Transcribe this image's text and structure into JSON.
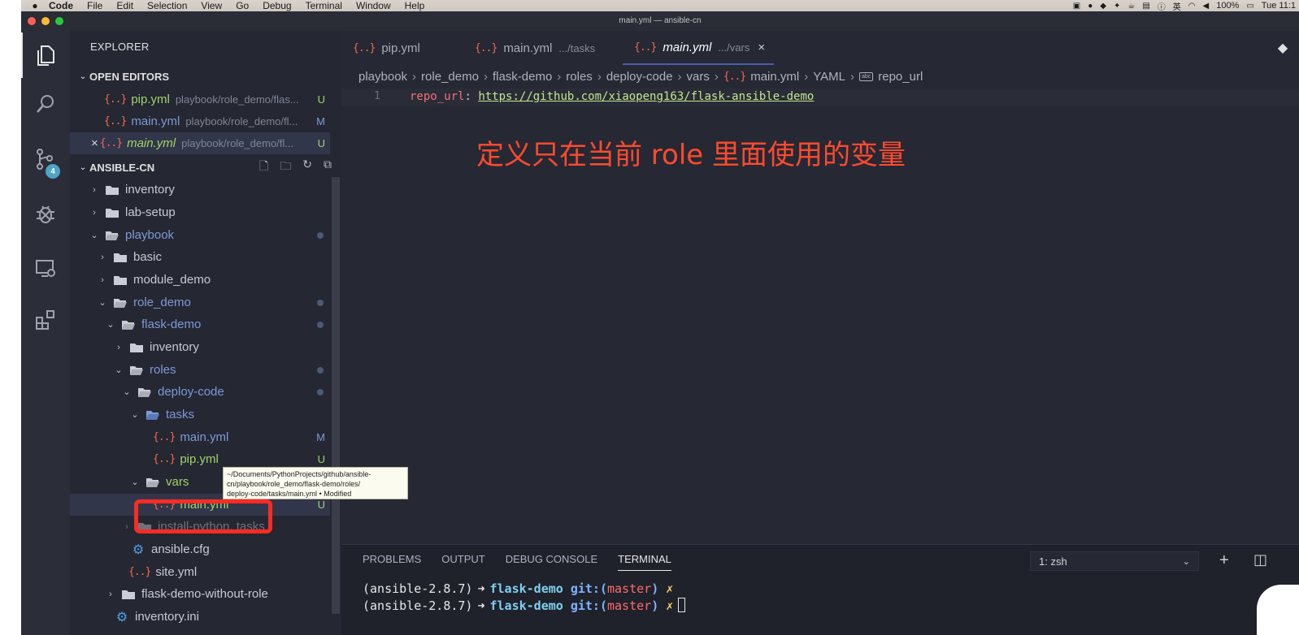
{
  "menubar": {
    "apple": "",
    "items": [
      "Code",
      "File",
      "Edit",
      "Selection",
      "View",
      "Go",
      "Debug",
      "Terminal",
      "Window",
      "Help"
    ],
    "status_icons": [
      "display-icon",
      "wechat-icon",
      "message-icon",
      "dropbox-icon",
      "cup-icon",
      "box-icon",
      "info-icon",
      "input-method-icon",
      "wifi-icon",
      "volume-icon"
    ],
    "input_method": "英",
    "battery": "100%",
    "clock": "Tue 11:1"
  },
  "window": {
    "title": "main.yml — ansible-cn"
  },
  "activitybar": {
    "source_control_badge": "4"
  },
  "sidebar": {
    "title": "EXPLORER",
    "open_editors_label": "OPEN EDITORS",
    "open_editors": [
      {
        "name": "pip.yml",
        "path": "playbook/role_demo/flas...",
        "status": "U"
      },
      {
        "name": "main.yml",
        "path": "playbook/role_demo/fl...",
        "status": "M"
      },
      {
        "name": "main.yml",
        "path": "playbook/role_demo/fl...",
        "status": "U",
        "close": "×"
      }
    ],
    "workspace_label": "ANSIBLE-CN",
    "tree": [
      {
        "name": "inventory"
      },
      {
        "name": "lab-setup"
      },
      {
        "name": "playbook"
      },
      {
        "name": "basic"
      },
      {
        "name": "module_demo"
      },
      {
        "name": "role_demo"
      },
      {
        "name": "flask-demo"
      },
      {
        "name": "inventory"
      },
      {
        "name": "roles"
      },
      {
        "name": "deploy-code"
      },
      {
        "name": "tasks"
      },
      {
        "name": "main.yml",
        "status": "M"
      },
      {
        "name": "pip.yml",
        "status": "U"
      },
      {
        "name": "vars"
      },
      {
        "name": "main.yml",
        "status": "U"
      },
      {
        "name": "install-python, tasks"
      },
      {
        "name": "ansible.cfg"
      },
      {
        "name": "site.yml"
      },
      {
        "name": "flask-demo-without-role"
      },
      {
        "name": "inventory.ini"
      }
    ]
  },
  "tooltip": {
    "lines": [
      "~/Documents/PythonProjects/github/ansible-",
      "cn/playbook/role_demo/flask-demo/roles/",
      "deploy-code/tasks/main.yml • Modified"
    ]
  },
  "editor": {
    "tabs": [
      {
        "label": "pip.yml",
        "sub": ""
      },
      {
        "label": "main.yml",
        "sub": ".../tasks"
      },
      {
        "label": "main.yml",
        "sub": ".../vars",
        "close": "×"
      }
    ],
    "breadcrumb": [
      "playbook",
      "role_demo",
      "flask-demo",
      "roles",
      "deploy-code",
      "vars",
      "main.yml",
      "YAML",
      "repo_url"
    ],
    "line_number": "1",
    "code_key": "repo_url",
    "code_colon": ":",
    "code_url": "https://github.com/xiaopeng163/flask-ansible-demo",
    "annotation": "定义只在当前 role 里面使用的变量"
  },
  "panel": {
    "tabs": [
      "PROBLEMS",
      "OUTPUT",
      "DEBUG CONSOLE",
      "TERMINAL"
    ],
    "terminal_select": "1: zsh",
    "terminal_lines": [
      {
        "env": "(ansible-2.8.7)",
        "arrow": "➜",
        "dir": "flask-demo",
        "git": "git:(",
        "branch": "master",
        "git_close": ")",
        "dirty": "✗"
      },
      {
        "env": "(ansible-2.8.7)",
        "arrow": "➜",
        "dir": "flask-demo",
        "git": "git:(",
        "branch": "master",
        "git_close": ")",
        "dirty": "✗"
      }
    ]
  },
  "colors": {
    "yaml_icon": "#f26b4f",
    "modified": "#7d9ad6",
    "untracked": "#9fd46a",
    "annotation": "#ff4a2e",
    "highlight_box": "#ff2b23"
  }
}
